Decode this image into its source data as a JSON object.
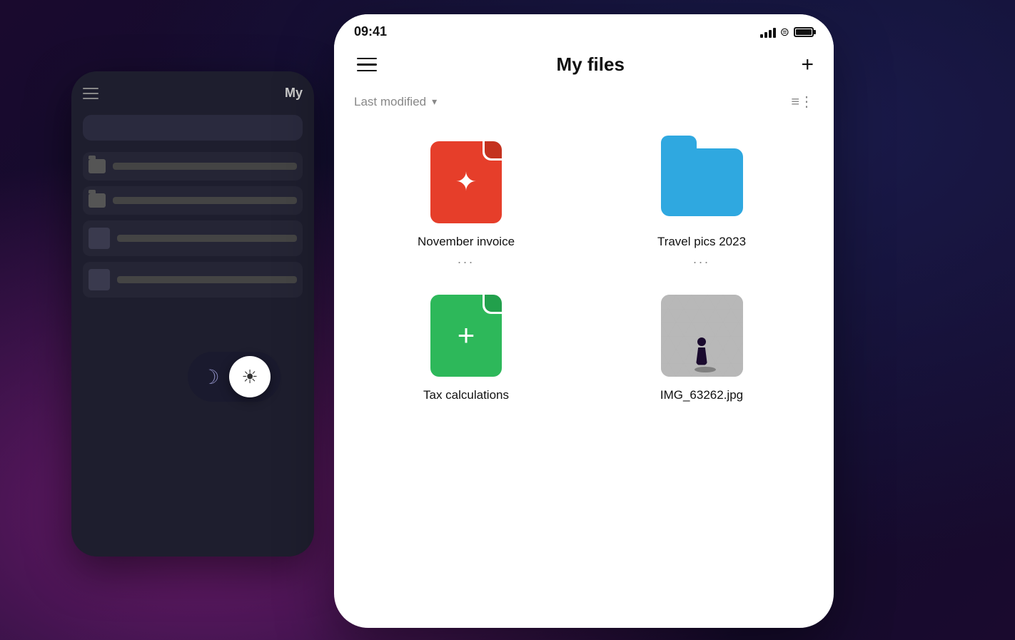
{
  "background": {
    "color": "#1a0a2e"
  },
  "dark_phone": {
    "title": "My",
    "items": [
      {
        "type": "folder",
        "label": ""
      },
      {
        "type": "folder",
        "label": ""
      },
      {
        "type": "image",
        "label": ""
      },
      {
        "type": "image",
        "label": ""
      }
    ]
  },
  "theme_toggle": {
    "label": "theme toggle",
    "mode": "light"
  },
  "light_phone": {
    "status_bar": {
      "time": "09:41",
      "signal": "signal",
      "wifi": "wifi",
      "battery": "battery"
    },
    "header": {
      "menu_label": "menu",
      "title": "My files",
      "add_label": "+"
    },
    "sort_bar": {
      "sort_label": "Last modified",
      "chevron": "▾",
      "view_icon": "≡⋮"
    },
    "files": [
      {
        "id": "november-invoice",
        "name": "November invoice",
        "type": "pdf",
        "menu": "..."
      },
      {
        "id": "travel-pics",
        "name": "Travel pics 2023",
        "type": "folder",
        "menu": "..."
      },
      {
        "id": "tax-calculations",
        "name": "Tax calculations",
        "type": "green-doc",
        "menu": ""
      },
      {
        "id": "img-file",
        "name": "IMG_63262.jpg",
        "type": "photo",
        "menu": ""
      }
    ]
  }
}
